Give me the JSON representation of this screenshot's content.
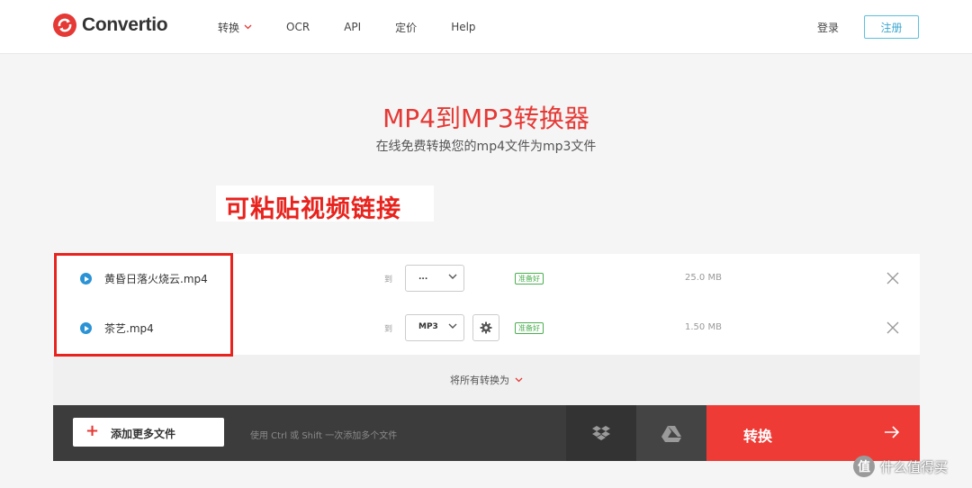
{
  "brand": {
    "name": "Convertio",
    "color": "#e53935"
  },
  "nav": [
    {
      "label": "转换",
      "has_dropdown": true
    },
    {
      "label": "OCR"
    },
    {
      "label": "API"
    },
    {
      "label": "定价"
    },
    {
      "label": "Help"
    }
  ],
  "auth": {
    "login": "登录",
    "register": "注册"
  },
  "hero": {
    "title": "MP4到MP3转换器",
    "subtitle": "在线免费转换您的mp4文件为mp3文件"
  },
  "annotation": {
    "text": "可粘贴视频链接",
    "color": "#e8231d"
  },
  "files": [
    {
      "name": "黄昏日落火烧云.mp4",
      "to_label": "到",
      "format": "...",
      "status": "准备好",
      "size": "25.0 MB",
      "has_settings": false
    },
    {
      "name": "茶艺.mp4",
      "to_label": "到",
      "format": "MP3",
      "status": "准备好",
      "size": "1.50 MB",
      "has_settings": true
    }
  ],
  "convert_all": {
    "label": "将所有转换为"
  },
  "bottom_bar": {
    "add_files": "添加更多文件",
    "hint": "使用 Ctrl 或 Shift 一次添加多个文件",
    "convert": "转换",
    "icons": [
      "dropbox-icon",
      "google-drive-icon"
    ]
  },
  "watermark": {
    "icon_char": "值",
    "text": "什么值得买"
  },
  "colors": {
    "accent": "#ef3b36",
    "info": "#2a93d5",
    "ready": "#4caf50"
  }
}
